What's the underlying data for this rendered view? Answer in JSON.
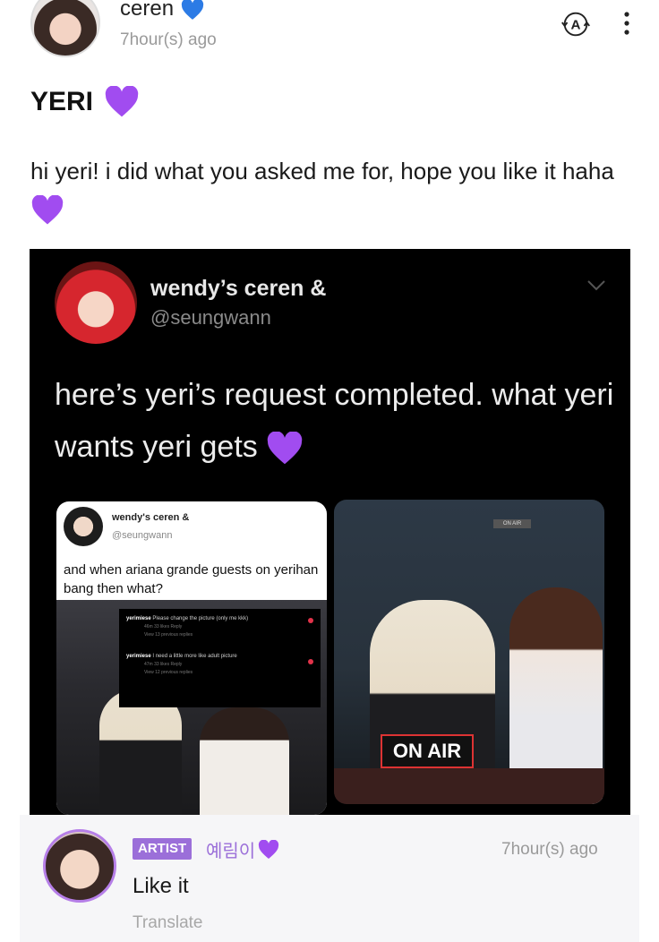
{
  "post": {
    "author": "ceren",
    "time": "7hour(s) ago",
    "title": "YERI",
    "body": "hi yeri! i did what you asked me for, hope you like it haha"
  },
  "tweet": {
    "name": "wendy’s ceren &",
    "handle": "@seungwann",
    "text": "here’s yeri’s request completed. what yeri wants yeri gets",
    "inner_card": {
      "name": "wendy's ceren &",
      "handle": "@seungwann",
      "text": "and when ariana grande guests on yerihan bang then what?",
      "comments": [
        {
          "user": "yerimiese",
          "text": "Please change the picture (only me kkk)",
          "meta": "46m   33 likes   Reply",
          "more": "View 13 previous replies"
        },
        {
          "user": "yerimiese",
          "text": "I need a little more like adult picture",
          "meta": "47m   33 likes   Reply",
          "more": "View 12 previous replies"
        }
      ]
    },
    "sign": "ON AIR",
    "sign_small": "ON AIR"
  },
  "comment": {
    "badge": "ARTIST",
    "name": "예림이",
    "time": "7hour(s) ago",
    "text": "Like it",
    "translate": "Translate"
  },
  "colors": {
    "accent": "#9b6fd9",
    "heart": "#a14cf0"
  },
  "icons": {
    "translate": "translate-icon",
    "more": "more-vertical-icon",
    "heart": "purple-heart-icon"
  }
}
